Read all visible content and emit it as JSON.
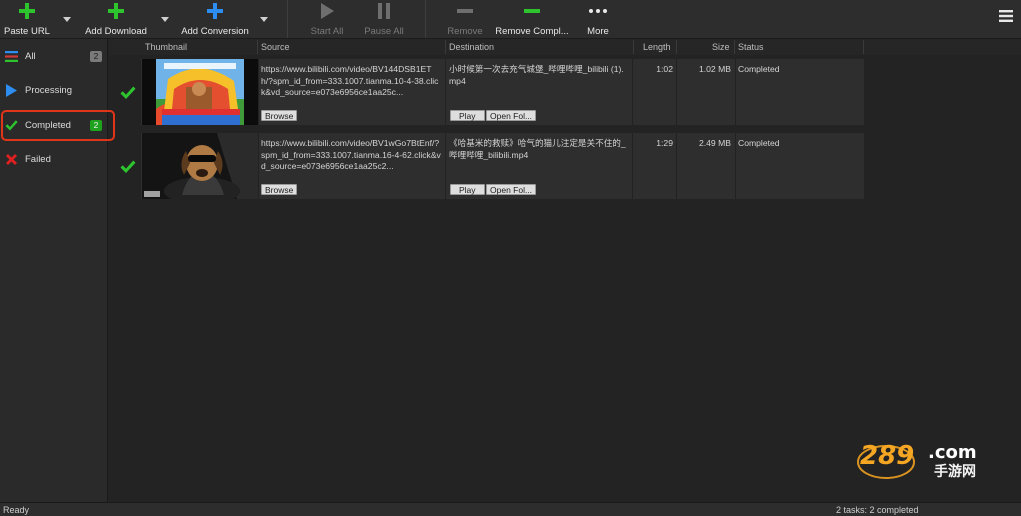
{
  "toolbar": {
    "paste_url": "Paste URL",
    "add_download": "Add Download",
    "add_conversion": "Add Conversion",
    "start_all": "Start All",
    "pause_all": "Pause All",
    "remove": "Remove",
    "remove_completed": "Remove Compl...",
    "more": "More"
  },
  "sidebar": {
    "items": [
      {
        "label": "All",
        "badge": "2"
      },
      {
        "label": "Processing",
        "badge": ""
      },
      {
        "label": "Completed",
        "badge": "2"
      },
      {
        "label": "Failed",
        "badge": ""
      }
    ]
  },
  "columns": {
    "thumbnail": "Thumbnail",
    "source": "Source",
    "destination": "Destination",
    "length": "Length",
    "size": "Size",
    "status": "Status"
  },
  "rows": [
    {
      "source": "https://www.bilibili.com/video/BV144DSB1ETh/?spm_id_from=333.1007.tianma.10-4-38.click&vd_source=e073e6956ce1aa25c...",
      "destination": "小时候第一次去充气城堡_哔哩哔哩_bilibili (1).mp4",
      "length": "1:02",
      "size": "1.02 MB",
      "status": "Completed",
      "browse_label": "Browse",
      "play_label": "Play",
      "open_folder_label": "Open Fol..."
    },
    {
      "source": "https://www.bilibili.com/video/BV1wGo7BtEnf/?spm_id_from=333.1007.tianma.16-4-62.click&vd_source=e073e6956ce1aa25c2...",
      "destination": "《哈基米的救赎》哈气的猫儿注定是关不住的_哔哩哔哩_bilibili.mp4",
      "length": "1:29",
      "size": "2.49 MB",
      "status": "Completed",
      "browse_label": "Browse",
      "play_label": "Play",
      "open_folder_label": "Open Fol..."
    }
  ],
  "statusbar": {
    "left": "Ready",
    "right": "2 tasks: 2 completed"
  },
  "watermark": {
    "logo_text": "289.com",
    "sub_text": "手游网"
  },
  "colors": {
    "accent_green": "#2ec42e",
    "accent_blue": "#2e8df0",
    "highlight_red": "#e03518",
    "failed_red": "#e02020"
  }
}
